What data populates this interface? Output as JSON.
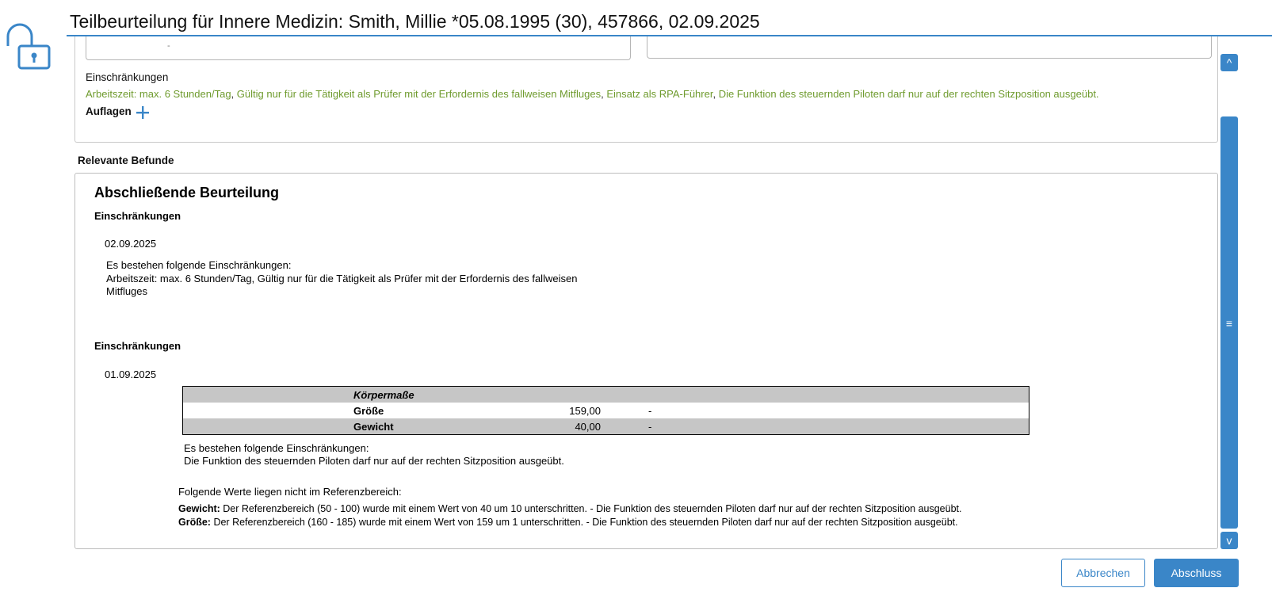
{
  "header": {
    "title": "Teilbeurteilung für Innere Medizin: Smith, Millie *05.08.1995 (30), 457866, 02.09.2025"
  },
  "top_section": {
    "field_value": "-",
    "restrictions_label": "Einschränkungen",
    "restrictions": [
      "Arbeitszeit: max. 6 Stunden/Tag",
      "Gültig nur für die Tätigkeit als Prüfer mit der Erfordernis des fallweisen Mitfluges",
      "Einsatz als RPA-Führer",
      "Die Funktion des steuernden Piloten darf nur auf der rechten Sitzposition ausgeübt."
    ],
    "separator": ", ",
    "auflagen_label": "Auflagen"
  },
  "relevante_befunde_label": "Relevante Befunde",
  "report": {
    "heading": "Abschließende Beurteilung",
    "block1": {
      "heading": "Einschränkungen",
      "date": "02.09.2025",
      "intro": "Es bestehen folgende Einschränkungen:",
      "text_line1": "Arbeitszeit: max. 6 Stunden/Tag, Gültig nur für die Tätigkeit als Prüfer mit der Erfordernis des fallweisen",
      "text_line2": "Mitfluges"
    },
    "block2": {
      "heading": "Einschränkungen",
      "date": "01.09.2025",
      "table": {
        "group": "Körpermaße",
        "rows": [
          {
            "name": "Größe",
            "value": "159,00",
            "flag": "-"
          },
          {
            "name": "Gewicht",
            "value": "40,00",
            "flag": "-"
          }
        ]
      },
      "intro": "Es bestehen folgende Einschränkungen:",
      "text": "Die Funktion des steuernden Piloten darf nur auf der rechten Sitzposition ausgeübt.",
      "ref_intro": "Folgende Werte liegen nicht im Referenzbereich:",
      "ref_items": [
        {
          "label": "Gewicht:",
          "text": " Der Referenzbereich (50 - 100) wurde mit einem Wert von 40 um 10 unterschritten. - Die Funktion des steuernden Piloten darf nur auf der rechten Sitzposition ausgeübt."
        },
        {
          "label": "Größe:",
          "text": " Der Referenzbereich (160 - 185) wurde mit einem Wert von 159 um 1 unterschritten. - Die Funktion des steuernden Piloten darf nur auf der rechten Sitzposition ausgeübt."
        }
      ]
    }
  },
  "scrollbar": {
    "up": "^",
    "grip": "≡",
    "down": "v"
  },
  "buttons": {
    "cancel": "Abbrechen",
    "finish": "Abschluss"
  },
  "colors": {
    "accent": "#3a86c8",
    "restriction_green": "#6f9b2e",
    "table_shade": "#c6c6c6"
  }
}
